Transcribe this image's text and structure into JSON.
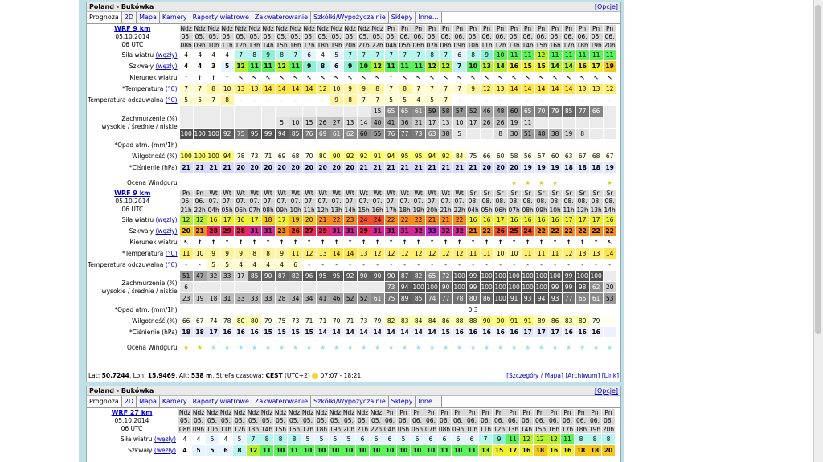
{
  "panel1": {
    "title": "Poland - Bukówka",
    "options": "[Opcje]",
    "tabs": [
      "Prognoza",
      "2D",
      "Mapa",
      "Kamery",
      "Raporty wiatrowe",
      "Zakwaterowanie",
      "Szkółki/Wypożyczalnie",
      "Sklepy",
      "Inne..."
    ],
    "block1": {
      "model": "WRF 9 km",
      "date": "05.10.2014",
      "utc": "06 UTC",
      "days": [
        "Ndz",
        "Ndz",
        "Ndz",
        "Ndz",
        "Ndz",
        "Ndz",
        "Ndz",
        "Ndz",
        "Ndz",
        "Ndz",
        "Ndz",
        "Ndz",
        "Ndz",
        "Ndz",
        "Ndz",
        "Pn",
        "Pn",
        "Pn",
        "Pn",
        "Pn",
        "Pn",
        "Pn",
        "Pn",
        "Pn",
        "Pn",
        "Pn",
        "Pn",
        "Pn",
        "Pn",
        "Pn",
        "Pn",
        "Pn"
      ],
      "dates": [
        "05.",
        "05.",
        "05.",
        "05.",
        "05.",
        "05.",
        "05.",
        "05.",
        "05.",
        "05.",
        "05.",
        "05.",
        "05.",
        "05.",
        "05.",
        "06.",
        "06.",
        "06.",
        "06.",
        "06.",
        "06.",
        "06.",
        "06.",
        "06.",
        "06.",
        "06.",
        "06.",
        "06.",
        "06.",
        "06.",
        "06.",
        "06."
      ],
      "hours": [
        "08h",
        "09h",
        "10h",
        "11h",
        "12h",
        "13h",
        "14h",
        "15h",
        "16h",
        "17h",
        "18h",
        "19h",
        "20h",
        "21h",
        "22h",
        "04h",
        "05h",
        "06h",
        "07h",
        "08h",
        "09h",
        "10h",
        "11h",
        "12h",
        "13h",
        "14h",
        "15h",
        "16h",
        "17h",
        "18h",
        "19h",
        "20h"
      ],
      "labels": {
        "wind": "Siła wiatru",
        "gust": "Szkwały",
        "unit": "(węzły)",
        "dir": "Kierunek wiatru",
        "temp": "*Temperatura",
        "tunit": "(°C)",
        "feel": "Temperatura odczuwalna",
        "cloud1": "Zachmurzenie (%)",
        "cloud2": "wysokie / średnie / niskie",
        "rain": "*Opad atm. (mm/1h)",
        "hum": "Wilgotność (%)",
        "press": "*Ciśnienie (hPa)",
        "rating": "Ocena Windguru"
      },
      "wind": [
        "4",
        "4",
        "4",
        "4",
        "7",
        "8",
        "9",
        "8",
        "7",
        "6",
        "4",
        "5",
        "7",
        "7",
        "7",
        "7",
        "7",
        "7",
        "8",
        "7",
        "6",
        "8",
        "9",
        "10",
        "11",
        "11",
        "12",
        "11",
        "11",
        "11",
        "11",
        "11"
      ],
      "gust": [
        "4",
        "4",
        "3",
        "5",
        "12",
        "11",
        "11",
        "12",
        "11",
        "9",
        "8",
        "6",
        "9",
        "10",
        "12",
        "11",
        "11",
        "11",
        "12",
        "12",
        "7",
        "10",
        "13",
        "14",
        "16",
        "15",
        "15",
        "14",
        "14",
        "16",
        "17",
        "19"
      ],
      "dir": [
        "↑",
        "↑",
        "↑",
        "↑",
        "↖",
        "↖",
        "↖",
        "↖",
        "↖",
        "↖",
        "↖",
        "↖",
        "↖",
        "↖",
        "↖",
        "↑",
        "↖",
        "↖",
        "↖",
        "↖",
        "↖",
        "↖",
        "↖",
        "↖",
        "↖",
        "↖",
        "↖",
        "↖",
        "↖",
        "↖",
        "↖",
        "↖"
      ],
      "temp": [
        "7",
        "7",
        "8",
        "10",
        "13",
        "13",
        "14",
        "14",
        "14",
        "14",
        "12",
        "10",
        "9",
        "9",
        "8",
        "7",
        "8",
        "7",
        "7",
        "7",
        "7",
        "9",
        "12",
        "13",
        "14",
        "14",
        "14",
        "14",
        "14",
        "13",
        "13",
        "12"
      ],
      "feel": [
        "5",
        "5",
        "7",
        "8",
        "-",
        "-",
        "-",
        "-",
        "-",
        "-",
        "-",
        "9",
        "8",
        "7",
        "7",
        "5",
        "5",
        "4",
        "5",
        "7",
        "-",
        "-",
        "-",
        "-",
        "-",
        "-",
        "-",
        "-",
        "-",
        "-",
        "-",
        "-"
      ],
      "hi": [
        "",
        "",
        "",
        "",
        "",
        "",
        "",
        "",
        "",
        "",
        "",
        "",
        "",
        "",
        "15",
        "65",
        "65",
        "61",
        "59",
        "58",
        "57",
        "52",
        "46",
        "48",
        "60",
        "65",
        "70",
        "79",
        "85",
        "77",
        "66",
        ""
      ],
      "mid": [
        "",
        "",
        "",
        "",
        "",
        "",
        "",
        "5",
        "10",
        "15",
        "26",
        "27",
        "13",
        "14",
        "40",
        "41",
        "36",
        "21",
        "17",
        "13",
        "10",
        "17",
        "26",
        "26",
        "19",
        "11",
        "",
        "",
        "",
        "",
        "",
        ""
      ],
      "lo": [
        "100",
        "100",
        "100",
        "92",
        "75",
        "95",
        "99",
        "94",
        "85",
        "76",
        "69",
        "61",
        "62",
        "60",
        "55",
        "76",
        "77",
        "73",
        "63",
        "38",
        "5",
        "",
        "",
        "8",
        "30",
        "51",
        "48",
        "38",
        "19",
        "8",
        "",
        ""
      ],
      "rain": [
        "-",
        "",
        "",
        "",
        "",
        "",
        "",
        "",
        "",
        "",
        "",
        "",
        "",
        "",
        "",
        "",
        "",
        "",
        "",
        "",
        "",
        "",
        "",
        "",
        "",
        "",
        "",
        "",
        "",
        "",
        "",
        ""
      ],
      "hum": [
        "100",
        "100",
        "100",
        "94",
        "78",
        "73",
        "71",
        "69",
        "68",
        "70",
        "80",
        "90",
        "92",
        "92",
        "91",
        "94",
        "95",
        "95",
        "94",
        "92",
        "84",
        "75",
        "66",
        "60",
        "58",
        "56",
        "57",
        "60",
        "63",
        "67",
        "68",
        "67"
      ],
      "press": [
        "21",
        "21",
        "21",
        "21",
        "20",
        "20",
        "20",
        "20",
        "20",
        "20",
        "20",
        "20",
        "20",
        "21",
        "21",
        "21",
        "21",
        "21",
        "21",
        "21",
        "21",
        "21",
        "20",
        "20",
        "20",
        "19",
        "19",
        "19",
        "18",
        "18",
        "18",
        "19"
      ],
      "rating": [
        "",
        "",
        "",
        "",
        "",
        "",
        "",
        "",
        "",
        "",
        "",
        "",
        "",
        "",
        "",
        "",
        "",
        "",
        "",
        "",
        "",
        "",
        "",
        "",
        "1",
        "1",
        "1",
        "1",
        "",
        "",
        "",
        "1"
      ]
    },
    "block2": {
      "model": "WRF 9 km",
      "date": "05.10.2014",
      "utc": "06 UTC",
      "days": [
        "Pn",
        "Pn",
        "Wt",
        "Wt",
        "Wt",
        "Wt",
        "Wt",
        "Wt",
        "Wt",
        "Wt",
        "Wt",
        "Wt",
        "Wt",
        "Wt",
        "Wt",
        "Wt",
        "Wt",
        "Wt",
        "Wt",
        "Wt",
        "Wt",
        "Śr",
        "Śr",
        "Śr",
        "Śr",
        "Śr",
        "Śr",
        "Śr",
        "Śr",
        "Śr",
        "Śr",
        "Śr"
      ],
      "dates": [
        "06.",
        "06.",
        "07.",
        "07.",
        "07.",
        "07.",
        "07.",
        "07.",
        "07.",
        "07.",
        "07.",
        "07.",
        "07.",
        "07.",
        "07.",
        "07.",
        "07.",
        "07.",
        "07.",
        "07.",
        "07.",
        "08.",
        "08.",
        "08.",
        "08.",
        "08.",
        "08.",
        "08.",
        "08.",
        "08.",
        "08.",
        "08."
      ],
      "hours": [
        "21h",
        "22h",
        "04h",
        "05h",
        "06h",
        "07h",
        "08h",
        "09h",
        "10h",
        "11h",
        "12h",
        "13h",
        "14h",
        "15h",
        "16h",
        "17h",
        "18h",
        "19h",
        "20h",
        "21h",
        "22h",
        "04h",
        "05h",
        "06h",
        "07h",
        "08h",
        "09h",
        "10h",
        "11h",
        "12h",
        "13h",
        "14h"
      ],
      "wind": [
        "12",
        "12",
        "16",
        "17",
        "16",
        "17",
        "18",
        "17",
        "19",
        "20",
        "21",
        "22",
        "23",
        "24",
        "24",
        "22",
        "22",
        "22",
        "21",
        "21",
        "22",
        "16",
        "16",
        "17",
        "16",
        "16",
        "16",
        "16",
        "17",
        "17",
        "17",
        "16"
      ],
      "gust": [
        "20",
        "21",
        "28",
        "29",
        "28",
        "31",
        "31",
        "23",
        "26",
        "27",
        "29",
        "31",
        "31",
        "29",
        "31",
        "31",
        "31",
        "32",
        "33",
        "32",
        "32",
        "21",
        "22",
        "26",
        "25",
        "24",
        "22",
        "22",
        "22",
        "22",
        "22",
        "22"
      ],
      "dir": [
        "↖",
        "↑",
        "↑",
        "↑",
        "↑",
        "↑",
        "↑",
        "↑",
        "↑",
        "↑",
        "↑",
        "↑",
        "↑",
        "↑",
        "↑",
        "↑",
        "↑",
        "↑",
        "↑",
        "↑",
        "↑",
        "↑",
        "↑",
        "↑",
        "↑",
        "↑",
        "↑",
        "↑",
        "↑",
        "↑",
        "↑",
        "↖"
      ],
      "temp": [
        "11",
        "10",
        "9",
        "9",
        "9",
        "8",
        "8",
        "9",
        "11",
        "12",
        "13",
        "14",
        "14",
        "13",
        "12",
        "12",
        "12",
        "12",
        "12",
        "12",
        "12",
        "11",
        "11",
        "10",
        "10",
        "11",
        "11",
        "11",
        "12",
        "13",
        "13",
        "14"
      ],
      "feel": [
        "-",
        "-",
        "5",
        "5",
        "4",
        "4",
        "4",
        "4",
        "6",
        "-",
        "-",
        "-",
        "-",
        "-",
        "-",
        "-",
        "-",
        "-",
        "-",
        "-",
        "-",
        "-",
        "-",
        "-",
        "-",
        "-",
        "-",
        "-",
        "-",
        "-",
        "-",
        "-"
      ],
      "hi": [
        "51",
        "47",
        "32",
        "33",
        "17",
        "85",
        "90",
        "87",
        "82",
        "96",
        "95",
        "95",
        "92",
        "90",
        "90",
        "90",
        "87",
        "82",
        "65",
        "72",
        "100",
        "99",
        "100",
        "100",
        "100",
        "100",
        "100",
        "100",
        "99",
        "100",
        "100",
        ""
      ],
      "mid": [
        "6",
        "",
        "",
        "",
        "",
        "",
        "",
        "",
        "",
        "",
        "",
        "",
        "",
        "",
        "",
        "73",
        "94",
        "100",
        "100",
        "90",
        "100",
        "99",
        "100",
        "100",
        "100",
        "100",
        "100",
        "99",
        "99",
        "98",
        "62",
        "20"
      ],
      "lo": [
        "23",
        "19",
        "18",
        "31",
        "33",
        "33",
        "33",
        "28",
        "34",
        "34",
        "41",
        "46",
        "52",
        "52",
        "61",
        "75",
        "89",
        "85",
        "74",
        "77",
        "78",
        "80",
        "86",
        "100",
        "91",
        "93",
        "94",
        "93",
        "77",
        "65",
        "61",
        "53"
      ],
      "rain": [
        "",
        "",
        "",
        "",
        "",
        "",
        "",
        "",
        "",
        "",
        "",
        "",
        "",
        "",
        "",
        "",
        "",
        "",
        "",
        "",
        "",
        "0.3",
        "",
        "",
        "",
        "",
        "",
        "",
        "",
        "",
        "",
        ""
      ],
      "hum": [
        "66",
        "67",
        "74",
        "78",
        "80",
        "80",
        "79",
        "75",
        "73",
        "71",
        "71",
        "70",
        "71",
        "73",
        "79",
        "82",
        "83",
        "84",
        "84",
        "86",
        "88",
        "88",
        "90",
        "90",
        "91",
        "91",
        "89",
        "86",
        "83",
        "80",
        "79",
        ""
      ],
      "press": [
        "18",
        "18",
        "17",
        "16",
        "16",
        "16",
        "15",
        "15",
        "15",
        "15",
        "14",
        "14",
        "14",
        "14",
        "14",
        "14",
        "14",
        "14",
        "14",
        "15",
        "16",
        "16",
        "16",
        "16",
        "16",
        "17",
        "17",
        "17",
        "16",
        "16",
        "16",
        ""
      ],
      "rating": [
        "1",
        "1",
        "2",
        "2",
        "2",
        "2",
        "2",
        "2",
        "3",
        "3",
        "3",
        "3",
        "3",
        "3",
        "3",
        "3",
        "3",
        "3",
        "3",
        "3",
        "3",
        "2",
        "2",
        "2",
        "2",
        "2",
        "2",
        "2",
        "2",
        "2",
        "2",
        "2"
      ]
    },
    "footer": {
      "lat": "Lat:",
      "latv": "50.7244",
      "lon": ", Lon:",
      "lonv": "15.9469",
      "alt": ", Alt:",
      "altv": "538 m",
      "tz": ", Strefa czasowa:",
      "tzv": "CEST",
      "tzn": "(UTC+2)",
      "sun": "07:07 - 18:21",
      "links": "[Szczegóły / Mapa] [Archiwum] [Link]"
    }
  },
  "panel2": {
    "title": "Poland - Bukówka",
    "options": "[Opcje]",
    "tabs": [
      "Prognoza",
      "2D",
      "Mapa",
      "Kamery",
      "Raporty wiatrowe",
      "Zakwaterowanie",
      "Szkółki/Wypożyczalnie",
      "Sklepy",
      "Inne..."
    ],
    "model": "WRF 27 km",
    "date": "05.10.2014",
    "utc": "06 UTC",
    "days": [
      "Ndz",
      "Ndz",
      "Ndz",
      "Ndz",
      "Ndz",
      "Ndz",
      "Ndz",
      "Ndz",
      "Ndz",
      "Ndz",
      "Ndz",
      "Ndz",
      "Ndz",
      "Ndz",
      "Ndz",
      "Pn",
      "Pn",
      "Pn",
      "Pn",
      "Pn",
      "Pn",
      "Pn",
      "Pn",
      "Pn",
      "Pn",
      "Pn",
      "Pn",
      "Pn",
      "Pn",
      "Pn",
      "Pn",
      "Pn"
    ],
    "dates": [
      "05.",
      "05.",
      "05.",
      "05.",
      "05.",
      "05.",
      "05.",
      "05.",
      "05.",
      "05.",
      "05.",
      "05.",
      "05.",
      "05.",
      "05.",
      "06.",
      "06.",
      "06.",
      "06.",
      "06.",
      "06.",
      "06.",
      "06.",
      "06.",
      "06.",
      "06.",
      "06.",
      "06.",
      "06.",
      "06.",
      "06.",
      "06."
    ],
    "hours": [
      "08h",
      "09h",
      "10h",
      "11h",
      "12h",
      "13h",
      "14h",
      "15h",
      "16h",
      "17h",
      "18h",
      "19h",
      "20h",
      "21h",
      "22h",
      "04h",
      "05h",
      "06h",
      "07h",
      "08h",
      "09h",
      "10h",
      "11h",
      "12h",
      "13h",
      "14h",
      "15h",
      "16h",
      "17h",
      "18h",
      "19h",
      "20h"
    ],
    "wind": [
      "4",
      "4",
      "5",
      "4",
      "5",
      "7",
      "8",
      "8",
      "8",
      "5",
      "5",
      "5",
      "5",
      "6",
      "6",
      "6",
      "5",
      "6",
      "6",
      "6",
      "6",
      "6",
      "7",
      "9",
      "11",
      "12",
      "12",
      "12",
      "11",
      "8",
      "8",
      "8"
    ],
    "gust": [
      "4",
      "5",
      "5",
      "6",
      "8",
      "12",
      "11",
      "10",
      "11",
      "10",
      "10",
      "10",
      "10",
      "10",
      "10",
      "10",
      "10",
      "10",
      "10",
      "11",
      "10",
      "11",
      "13",
      "15",
      "17",
      "16",
      "18",
      "16",
      "16",
      "18",
      "18",
      "20"
    ]
  },
  "colors": {
    "page": "#bfe0e6"
  }
}
